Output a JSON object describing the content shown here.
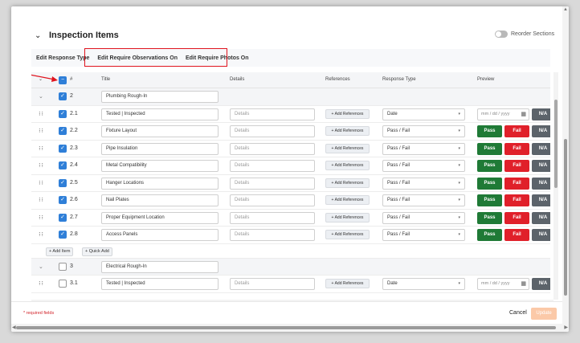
{
  "section": {
    "title": "Inspection Items",
    "reorder_label": "Reorder Sections"
  },
  "toolbar": {
    "edit_response_type": "Edit Response Type",
    "edit_require_observations": "Edit Require Observations On",
    "edit_require_photos": "Edit Require Photos On"
  },
  "columns": {
    "num": "#",
    "title": "Title",
    "details": "Details",
    "references": "References",
    "response_type": "Response Type",
    "preview": "Preview"
  },
  "common": {
    "details_placeholder": "Details",
    "add_references": "+ Add References",
    "date_placeholder": "mm / dd / yyyy",
    "pass": "Pass",
    "fail": "Fail",
    "na": "N/A",
    "add_item": "+ Add Item",
    "quick_add": "+ Quick Add"
  },
  "groups": [
    {
      "num": "2",
      "title": "Plumbing Rough-In",
      "checked": true,
      "items": [
        {
          "num": "2.1",
          "title": "Tested | Inspected",
          "response": "Date",
          "checked": true
        },
        {
          "num": "2.2",
          "title": "Fixture Layout",
          "response": "Pass / Fail",
          "checked": true
        },
        {
          "num": "2.3",
          "title": "Pipe Insulation",
          "response": "Pass / Fail",
          "checked": true
        },
        {
          "num": "2.4",
          "title": "Metal Compatibility",
          "response": "Pass / Fail",
          "checked": true
        },
        {
          "num": "2.5",
          "title": "Hanger Locations",
          "response": "Pass / Fail",
          "checked": true
        },
        {
          "num": "2.6",
          "title": "Nail Plates",
          "response": "Pass / Fail",
          "checked": true
        },
        {
          "num": "2.7",
          "title": "Proper Equipment Location",
          "response": "Pass / Fail",
          "checked": true
        },
        {
          "num": "2.8",
          "title": "Access Panels",
          "response": "Pass / Fail",
          "checked": true
        }
      ]
    },
    {
      "num": "3",
      "title": "Electrical Rough-In",
      "checked": false,
      "items": [
        {
          "num": "3.1",
          "title": "Tested | Inspected",
          "response": "Date",
          "checked": false
        }
      ]
    }
  ],
  "footer": {
    "required_note": "* required fields",
    "cancel": "Cancel",
    "update": "Update"
  },
  "colors": {
    "pass": "#1f7a36",
    "fail": "#e0202a",
    "na": "#5c636a",
    "checkbox": "#2f7fd8",
    "highlight": "#e0141e",
    "update": "#fbc9a8"
  }
}
